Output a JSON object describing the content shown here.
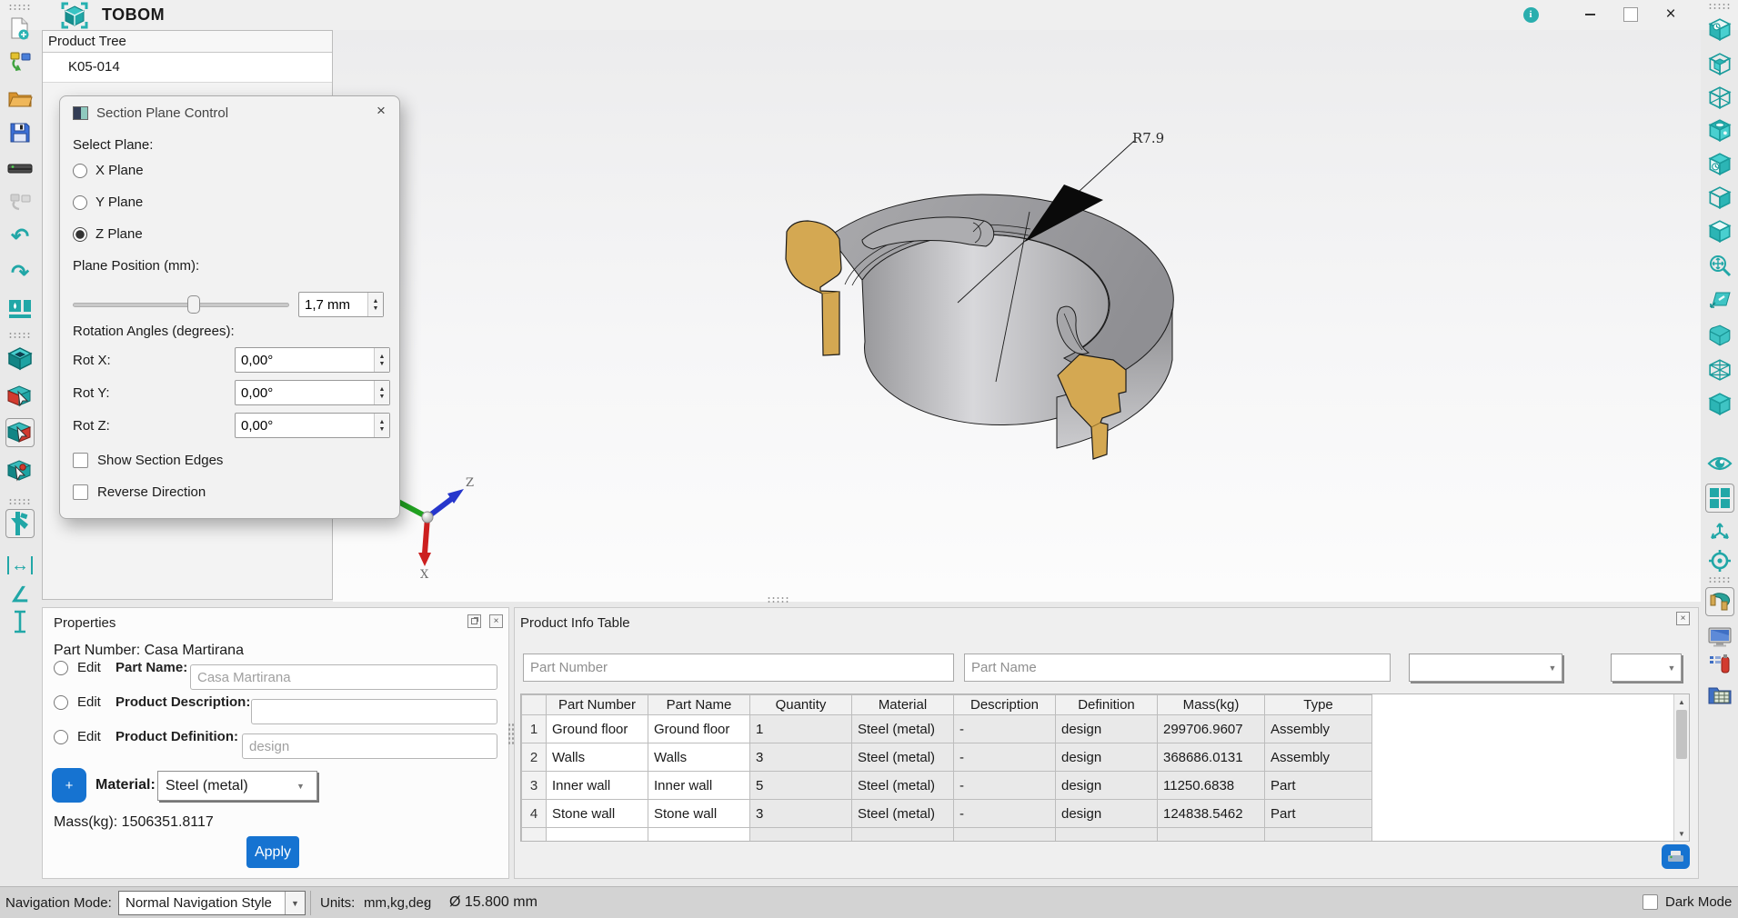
{
  "app": {
    "title": "TOBOM"
  },
  "window_controls": {
    "info_glyph": "i",
    "close_glyph": "×"
  },
  "product_tree": {
    "title": "Product Tree",
    "items": [
      {
        "label": "K05-014"
      }
    ]
  },
  "left_toolbar": {
    "items": [
      {
        "name": "new-file"
      },
      {
        "name": "assembly-import"
      },
      {
        "name": "open-folder"
      },
      {
        "name": "save"
      },
      {
        "name": "storage-drive"
      },
      {
        "name": "assembly-disabled"
      },
      {
        "name": "undo"
      },
      {
        "name": "redo"
      },
      {
        "name": "render-image"
      },
      {
        "name": "view-cube"
      },
      {
        "name": "section-by-face"
      },
      {
        "name": "section-plane"
      },
      {
        "name": "section-by-point"
      },
      {
        "name": "measure-caliper"
      },
      {
        "name": "measure-distance"
      },
      {
        "name": "measure-angle"
      },
      {
        "name": "measure-vertical"
      }
    ],
    "glyphs": {
      "undo": "↶",
      "redo": "↷",
      "angle": "∠",
      "distance": "↔"
    }
  },
  "right_toolbar": {
    "items": [
      {
        "name": "view-iso-back"
      },
      {
        "name": "view-wireframe-solid"
      },
      {
        "name": "view-wireframe"
      },
      {
        "name": "view-open-cube"
      },
      {
        "name": "view-iso-front"
      },
      {
        "name": "view-hidden-line"
      },
      {
        "name": "view-shaded"
      },
      {
        "name": "zoom-fit"
      },
      {
        "name": "sketch-plane"
      },
      {
        "name": "solid-round-cube"
      },
      {
        "name": "wire-globe"
      },
      {
        "name": "solid-cube"
      },
      {
        "name": "visibility-eye"
      },
      {
        "name": "four-views"
      },
      {
        "name": "axis-arrows"
      },
      {
        "name": "origin-target"
      },
      {
        "name": "section-ring"
      },
      {
        "name": "display-monitor"
      },
      {
        "name": "parts-list"
      },
      {
        "name": "report-table"
      }
    ]
  },
  "section_dialog": {
    "title": "Section Plane Control",
    "close_glyph": "×",
    "select_plane_label": "Select Plane:",
    "planes": [
      {
        "label": "X Plane",
        "selected": false
      },
      {
        "label": "Y Plane",
        "selected": false
      },
      {
        "label": "Z Plane",
        "selected": true
      }
    ],
    "plane_position_label": "Plane Position (mm):",
    "plane_position_value": "1,7 mm",
    "slider_percent": 53,
    "rotation_label": "Rotation Angles (degrees):",
    "rotations": [
      {
        "label": "Rot X:",
        "value": "0,00°"
      },
      {
        "label": "Rot Y:",
        "value": "0,00°"
      },
      {
        "label": "Rot Z:",
        "value": "0,00°"
      }
    ],
    "checkboxes": [
      {
        "label": "Show Section Edges",
        "checked": false
      },
      {
        "label": "Reverse Direction",
        "checked": false
      }
    ]
  },
  "viewport": {
    "annotation": "R7.9",
    "axis_labels": {
      "z": "Z",
      "x": "X"
    },
    "model_colors": {
      "body_gray": "#a2a2a5",
      "cut_gold": "#d4a852",
      "edge": "#1a1a1a"
    }
  },
  "properties": {
    "title": "Properties",
    "part_number_line": "Part Number: Casa Martirana",
    "rows": [
      {
        "edit_label": "Edit",
        "field_label": "Part Name:",
        "placeholder": "Casa Martirana"
      },
      {
        "edit_label": "Edit",
        "field_label": "Product Description:",
        "placeholder": ""
      },
      {
        "edit_label": "Edit",
        "field_label": "Product Definition:",
        "placeholder": "design"
      }
    ],
    "add_button_label": "+",
    "material_label": "Material:",
    "material_value": "Steel (metal)",
    "mass_line": "Mass(kg): 1506351.8117",
    "apply_label": "Apply"
  },
  "product_info": {
    "title": "Product Info Table",
    "close_glyph": "×",
    "filters": {
      "part_number_placeholder": "Part Number",
      "part_name_placeholder": "Part Name"
    },
    "columns": [
      "Part Number",
      "Part Name",
      "Quantity",
      "Material",
      "Description",
      "Definition",
      "Mass(kg)",
      "Type"
    ],
    "rows": [
      {
        "num": "1",
        "cells": [
          "Ground floor",
          "Ground floor",
          "1",
          "Steel (metal)",
          "-",
          "design",
          "299706.9607",
          "Assembly"
        ]
      },
      {
        "num": "2",
        "cells": [
          "Walls",
          "Walls",
          "3",
          "Steel (metal)",
          "-",
          "design",
          "368686.0131",
          "Assembly"
        ]
      },
      {
        "num": "3",
        "cells": [
          "Inner wall",
          "Inner wall",
          "5",
          "Steel (metal)",
          "-",
          "design",
          "11250.6838",
          "Part"
        ]
      },
      {
        "num": "4",
        "cells": [
          "Stone wall",
          "Stone wall",
          "3",
          "Steel (metal)",
          "-",
          "design",
          "124838.5462",
          "Part"
        ]
      }
    ]
  },
  "status_bar": {
    "navigation_label": "Navigation Mode:",
    "navigation_value": "Normal Navigation Style",
    "units_label": "Units:",
    "units_value": "mm,kg,deg",
    "diameter_readout": "Ø 15.800 mm",
    "dark_mode_label": "Dark Mode"
  },
  "colors": {
    "accent_teal": "#21a7a7",
    "accent_blue": "#1673d1",
    "gold": "#d4a852"
  }
}
